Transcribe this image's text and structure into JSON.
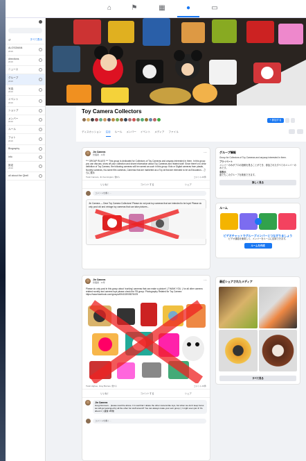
{
  "group": {
    "title": "Toy Camera Collectors",
    "join_label": "+ 参加する"
  },
  "tabs": [
    "ディスカッション",
    "注目",
    "ルール",
    "メンバー",
    "イベント",
    "メディア",
    "ファイル"
  ],
  "sidebar": {
    "top_link": "すべて表示",
    "rows": [
      {
        "title": "ALOSOMAN",
        "sub": "2019"
      },
      {
        "title": "directions",
        "sub": "2019"
      },
      {
        "title": "ニュース",
        "sub": ""
      },
      {
        "title": "グループ",
        "sub": "2019"
      },
      {
        "title": "写真",
        "sub": "2019"
      },
      {
        "title": "イベント",
        "sub": "2019"
      },
      {
        "title": "ショップ",
        "sub": ""
      },
      {
        "title": "メンバー",
        "sub": "2019"
      },
      {
        "title": "ルール",
        "sub": ""
      },
      {
        "title": "フォト",
        "sub": "2019"
      },
      {
        "title": "Biography",
        "sub": ""
      },
      {
        "title": "info",
        "sub": ""
      },
      {
        "title": "設定",
        "sub": "2019"
      },
      {
        "title": "all about the Qbell",
        "sub": ""
      }
    ]
  },
  "posts": [
    {
      "name": "Jin Camera",
      "time": "管理者 · 11年",
      "text": "*** GROUP RULES *** This group is dedicated for Collectors of Toy Cameras and anyway interested in them. In this group you can discuss, show off your collection and share information about Toy Cameras and related stuff. Since there's no clear definition of Toy Camera, the following cameras will be named as such in this group: Kids or Digital cameras from plastic, Novelty cameras, No-name film cameras, Cameras that are marketed as a Toy at that are intended to be as Education... さらに表示",
      "reactions": "Tsuki Camera, Jin Kennington, 他6人",
      "comments": "コメント20件",
      "inner_text": "Jin Camera — Dear Toy Camera Collectors! Please do not post toy cameras that are intended to be toys! Please do only post old and vintage toy cameras that can take pictures..."
    },
    {
      "name": "Jin Camera",
      "time": "管理者 · 11年",
      "text": "Please do only post in this group about 'working' cameras that can make a picture! ( THANK YOU. ) for all other camera related novelty and camera toys please check the FB group: Photography Related for Toy Camera https://www.facebook.com/groups/694153905578478",
      "reactions": "Tsuki Higbee, Gray Barnes, 他7人",
      "comments": "コメント19件",
      "reply_name": "Jin Camera",
      "reply_text": "Greg Donovan... please read the above. It is sad that I delete the other camera like toys, but when we don't keep focus we will get swamped by all the other fun stuff around!! You can always make your own group :) I might even join it! It's about it :) 返信 4年前"
    }
  ],
  "actions": {
    "like": "いいね！",
    "comment": "コメントする",
    "share": "シェア"
  },
  "comment_placeholder": "コメントを書く…",
  "about": {
    "title": "グループ情報",
    "text": "Group for Collectors of Toy Cameras and anyway interested in them.",
    "privacy": "プライベート",
    "privacy_desc": "メンバーのみがプロの投稿を見ることができ、参加されたすべてのメンバーのみです。",
    "visible": "非表示",
    "visible_desc": "誰でもこのグループを検索できます。",
    "more_button": "詳しく見る"
  },
  "rooms": {
    "title": "ルーム",
    "text": "ビデオチャットでグループメンバーとつながりましょう",
    "sub": "ビデオ通話を使用して、メンバーをルームに招待できます。",
    "button": "ルームを作成"
  },
  "media": {
    "title": "最近シェアされたメディア",
    "button": "すべて見る"
  },
  "colors": {
    "accent": "#1877f2",
    "bg": "#f0f2f5"
  }
}
